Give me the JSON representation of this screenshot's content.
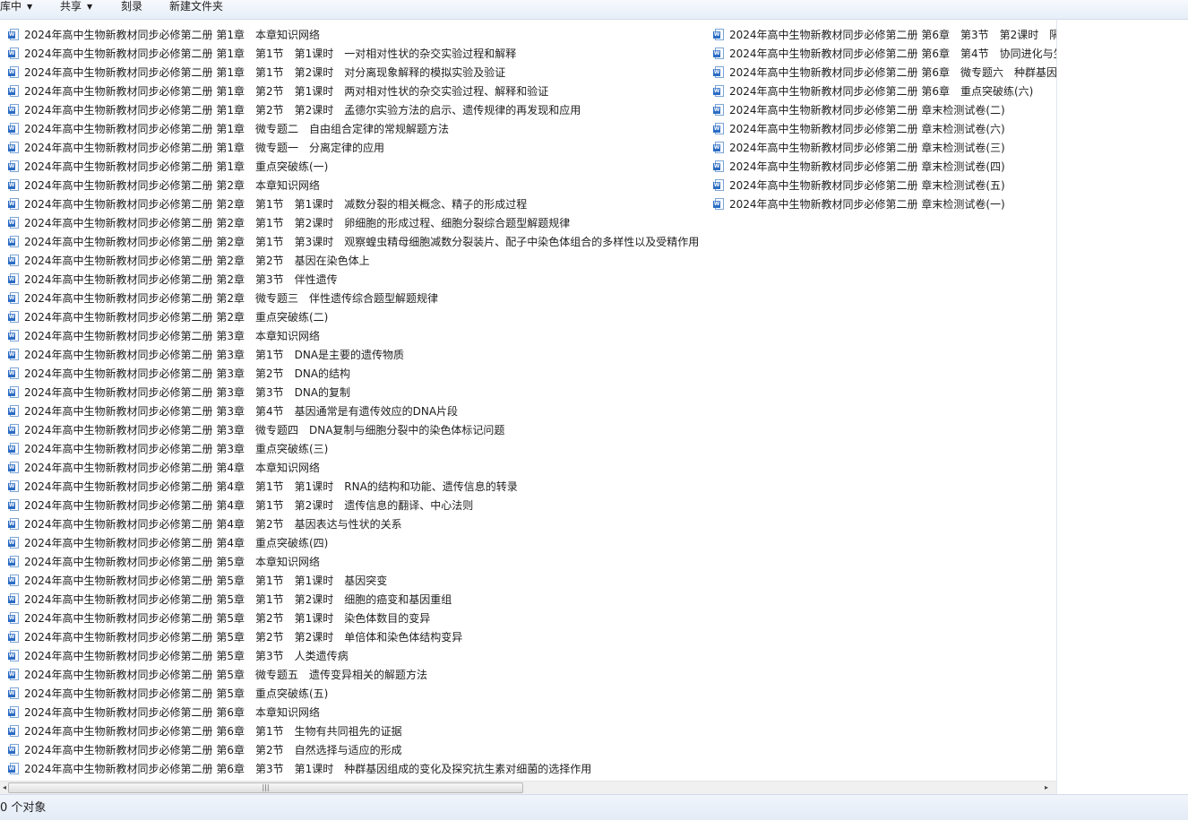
{
  "toolbar": {
    "library_label": "库中",
    "share_label": "共享",
    "burn_label": "刻录",
    "new_folder_label": "新建文件夹"
  },
  "files_left": [
    "2024年高中生物新教材同步必修第二册 第1章　本章知识网络",
    "2024年高中生物新教材同步必修第二册 第1章　第1节　第1课时　一对相对性状的杂交实验过程和解释",
    "2024年高中生物新教材同步必修第二册 第1章　第1节　第2课时　对分离现象解释的模拟实验及验证",
    "2024年高中生物新教材同步必修第二册 第1章　第2节　第1课时　两对相对性状的杂交实验过程、解释和验证",
    "2024年高中生物新教材同步必修第二册 第1章　第2节　第2课时　孟德尔实验方法的启示、遗传规律的再发现和应用",
    "2024年高中生物新教材同步必修第二册 第1章　微专题二　自由组合定律的常规解题方法",
    "2024年高中生物新教材同步必修第二册 第1章　微专题一　分离定律的应用",
    "2024年高中生物新教材同步必修第二册 第1章　重点突破练(一)",
    "2024年高中生物新教材同步必修第二册 第2章　本章知识网络",
    "2024年高中生物新教材同步必修第二册 第2章　第1节　第1课时　减数分裂的相关概念、精子的形成过程",
    "2024年高中生物新教材同步必修第二册 第2章　第1节　第2课时　卵细胞的形成过程、细胞分裂综合题型解题规律",
    "2024年高中生物新教材同步必修第二册 第2章　第1节　第3课时　观察蝗虫精母细胞减数分裂装片、配子中染色体组合的多样性以及受精作用",
    "2024年高中生物新教材同步必修第二册 第2章　第2节　基因在染色体上",
    "2024年高中生物新教材同步必修第二册 第2章　第3节　伴性遗传",
    "2024年高中生物新教材同步必修第二册 第2章　微专题三　伴性遗传综合题型解题规律",
    "2024年高中生物新教材同步必修第二册 第2章　重点突破练(二)",
    "2024年高中生物新教材同步必修第二册 第3章　本章知识网络",
    "2024年高中生物新教材同步必修第二册 第3章　第1节　DNA是主要的遗传物质",
    "2024年高中生物新教材同步必修第二册 第3章　第2节　DNA的结构",
    "2024年高中生物新教材同步必修第二册 第3章　第3节　DNA的复制",
    "2024年高中生物新教材同步必修第二册 第3章　第4节　基因通常是有遗传效应的DNA片段",
    "2024年高中生物新教材同步必修第二册 第3章　微专题四　DNA复制与细胞分裂中的染色体标记问题",
    "2024年高中生物新教材同步必修第二册 第3章　重点突破练(三)",
    "2024年高中生物新教材同步必修第二册 第4章　本章知识网络",
    "2024年高中生物新教材同步必修第二册 第4章　第1节　第1课时　RNA的结构和功能、遗传信息的转录",
    "2024年高中生物新教材同步必修第二册 第4章　第1节　第2课时　遗传信息的翻译、中心法则",
    "2024年高中生物新教材同步必修第二册 第4章　第2节　基因表达与性状的关系",
    "2024年高中生物新教材同步必修第二册 第4章　重点突破练(四)",
    "2024年高中生物新教材同步必修第二册 第5章　本章知识网络",
    "2024年高中生物新教材同步必修第二册 第5章　第1节　第1课时　基因突变",
    "2024年高中生物新教材同步必修第二册 第5章　第1节　第2课时　细胞的癌变和基因重组",
    "2024年高中生物新教材同步必修第二册 第5章　第2节　第1课时　染色体数目的变异",
    "2024年高中生物新教材同步必修第二册 第5章　第2节　第2课时　单倍体和染色体结构变异",
    "2024年高中生物新教材同步必修第二册 第5章　第3节　人类遗传病",
    "2024年高中生物新教材同步必修第二册 第5章　微专题五　遗传变异相关的解题方法",
    "2024年高中生物新教材同步必修第二册 第5章　重点突破练(五)",
    "2024年高中生物新教材同步必修第二册 第6章　本章知识网络",
    "2024年高中生物新教材同步必修第二册 第6章　第1节　生物有共同祖先的证据",
    "2024年高中生物新教材同步必修第二册 第6章　第2节　自然选择与适应的形成",
    "2024年高中生物新教材同步必修第二册 第6章　第3节　第1课时　种群基因组成的变化及探究抗生素对细菌的选择作用"
  ],
  "files_right": [
    "2024年高中生物新教材同步必修第二册 第6章　第3节　第2课时　隔",
    "2024年高中生物新教材同步必修第二册 第6章　第4节　协同进化与生",
    "2024年高中生物新教材同步必修第二册 第6章　微专题六　种群基因",
    "2024年高中生物新教材同步必修第二册 第6章　重点突破练(六)",
    "2024年高中生物新教材同步必修第二册 章末检测试卷(二)",
    "2024年高中生物新教材同步必修第二册 章末检测试卷(六)",
    "2024年高中生物新教材同步必修第二册 章末检测试卷(三)",
    "2024年高中生物新教材同步必修第二册 章末检测试卷(四)",
    "2024年高中生物新教材同步必修第二册 章末检测试卷(五)",
    "2024年高中生物新教材同步必修第二册 章末检测试卷(一)"
  ],
  "file_icon": "word-document-icon",
  "status": {
    "count_text": "0 个对象"
  },
  "colors": {
    "toolbar_bg": "#e6eef8",
    "icon_blue": "#2b6cc4"
  }
}
